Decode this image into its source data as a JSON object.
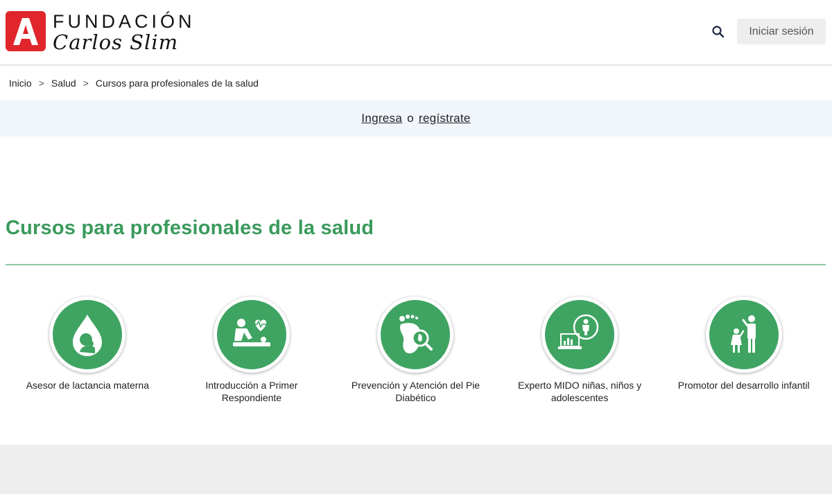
{
  "header": {
    "logo_line1": "FUNDACIÓN",
    "logo_line2": "Carlos Slim",
    "search_icon": "search-icon",
    "login_label": "Iniciar sesión"
  },
  "breadcrumb": {
    "items": [
      "Inicio",
      "Salud",
      "Cursos para profesionales de la salud"
    ],
    "separator": ">"
  },
  "auth_bar": {
    "login_link": "Ingresa",
    "or_text": "o",
    "register_link": "regístrate"
  },
  "section": {
    "title": "Cursos para profesionales de la salud"
  },
  "courses": [
    {
      "label": "Asesor de lactancia materna",
      "icon": "breastfeeding-drop-icon"
    },
    {
      "label": "Introducción a Primer Respondiente",
      "icon": "cpr-heartbeat-icon"
    },
    {
      "label": "Prevención y Atención del Pie Diabético",
      "icon": "foot-magnifier-icon"
    },
    {
      "label": "Experto MIDO niñas, niños y adolescentes",
      "icon": "laptop-child-icon"
    },
    {
      "label": "Promotor del desarrollo infantil",
      "icon": "adult-child-icon"
    }
  ],
  "colors": {
    "brand_red": "#e0262b",
    "accent_green": "#3fa462",
    "title_green": "#3a9a5c",
    "auth_bar_bg": "#f1f5fc"
  }
}
